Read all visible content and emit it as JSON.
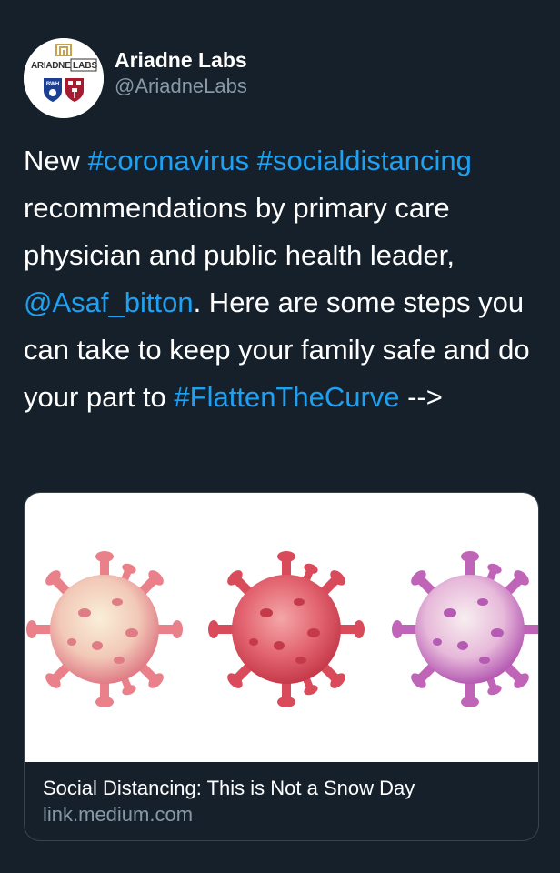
{
  "author": {
    "display_name": "Ariadne Labs",
    "handle": "@AriadneLabs",
    "avatar": {
      "logo_text_left": "ARIADNE",
      "logo_text_right": "LABS",
      "shield_left_text": "BWH",
      "brand_color": "#c8a24a"
    }
  },
  "tweet": {
    "segments": [
      {
        "text": "New ",
        "type": "text"
      },
      {
        "text": "#coronavirus",
        "type": "link"
      },
      {
        "text": " ",
        "type": "text"
      },
      {
        "text": "#socialdistancing",
        "type": "link"
      },
      {
        "text": " recommendations by primary care physician and public health leader, ",
        "type": "text"
      },
      {
        "text": "@Asaf_bitton",
        "type": "link"
      },
      {
        "text": ". Here are some steps you can take to keep your family safe and do your part to ",
        "type": "text"
      },
      {
        "text": "#FlattenTheCurve",
        "type": "link"
      },
      {
        "text": " -->",
        "type": "text"
      }
    ]
  },
  "card": {
    "image_description_icon": "virus-illustration",
    "title": "Social Distancing: This is Not a Snow Day",
    "domain": "link.medium.com"
  },
  "colors": {
    "background": "#15202b",
    "link": "#1da1f2",
    "secondary_text": "#8899a6",
    "card_border": "#38444d"
  }
}
